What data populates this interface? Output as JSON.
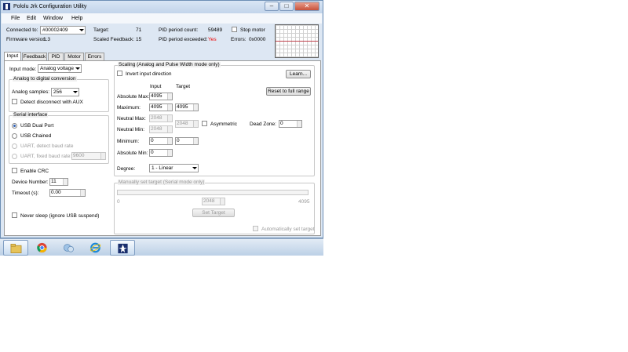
{
  "window": {
    "title": "Pololu Jrk Configuration Utility"
  },
  "menu": [
    "File",
    "Edit",
    "Window",
    "Help"
  ],
  "status": {
    "connected_label": "Connected to:",
    "connected_value": "#00002409",
    "firmware_label": "Firmware version:",
    "firmware_value": "1.3",
    "target_label": "Target:",
    "target_value": "71",
    "scaled_label": "Scaled Feedback:",
    "scaled_value": "15",
    "pid_count_label": "PID period count:",
    "pid_count_value": "59489",
    "pid_exceeded_label": "PID period exceeded:",
    "pid_exceeded_value": "Yes",
    "stop_motor_label": "Stop motor",
    "errors_label": "Errors:",
    "errors_value": "0x0000"
  },
  "tabs": [
    "Input",
    "Feedback",
    "PID",
    "Motor",
    "Errors"
  ],
  "input": {
    "mode_label": "Input mode:",
    "mode_value": "Analog voltage",
    "adc_group": "Analog to digital conversion",
    "samples_label": "Analog samples:",
    "samples_value": "256",
    "detect_aux": "Detect disconnect with AUX",
    "serial_group": "Serial interface",
    "usb_dual": "USB Dual Port",
    "usb_chained": "USB Chained",
    "uart_detect": "UART, detect baud rate",
    "uart_fixed": "UART, fixed baud rate:",
    "baud_value": "9600",
    "enable_crc": "Enable CRC",
    "device_number_label": "Device Number:",
    "device_number_value": "11",
    "timeout_label": "Timeout (s):",
    "timeout_value": "0.00",
    "never_sleep": "Never sleep (ignore USB suspend)"
  },
  "scaling": {
    "group": "Scaling (Analog and Pulse Width mode only)",
    "invert": "Invert input direction",
    "learn": "Learn...",
    "input_header": "Input",
    "target_header": "Target",
    "reset": "Reset to full range",
    "abs_max_label": "Absolute Max:",
    "abs_max_input": "4095",
    "max_label": "Maximum:",
    "max_input": "4095",
    "max_target": "4095",
    "neutral_max_label": "Neutral Max:",
    "neutral_max_input": "2048",
    "neutral_min_label": "Neutral Min:",
    "neutral_min_input": "2048",
    "neutral_target": "2048",
    "asymmetric": "Asymmetric",
    "dead_zone_label": "Dead Zone:",
    "dead_zone_value": "0",
    "min_label": "Minimum:",
    "min_input": "0",
    "min_target": "0",
    "abs_min_label": "Absolute Min:",
    "abs_min_input": "0",
    "degree_label": "Degree:",
    "degree_value": "1 - Linear"
  },
  "manual": {
    "group": "Manually set target (Serial mode only)",
    "min": "0",
    "max": "4095",
    "value": "2048",
    "set_target": "Set Target",
    "auto": "Automatically set target"
  },
  "colors": {
    "error_red": "#e00000",
    "graph_line": "#c0404a"
  },
  "taskbar": [
    "explorer-icon",
    "chrome-icon",
    "network-icon",
    "ie-icon",
    "pololu-icon"
  ]
}
